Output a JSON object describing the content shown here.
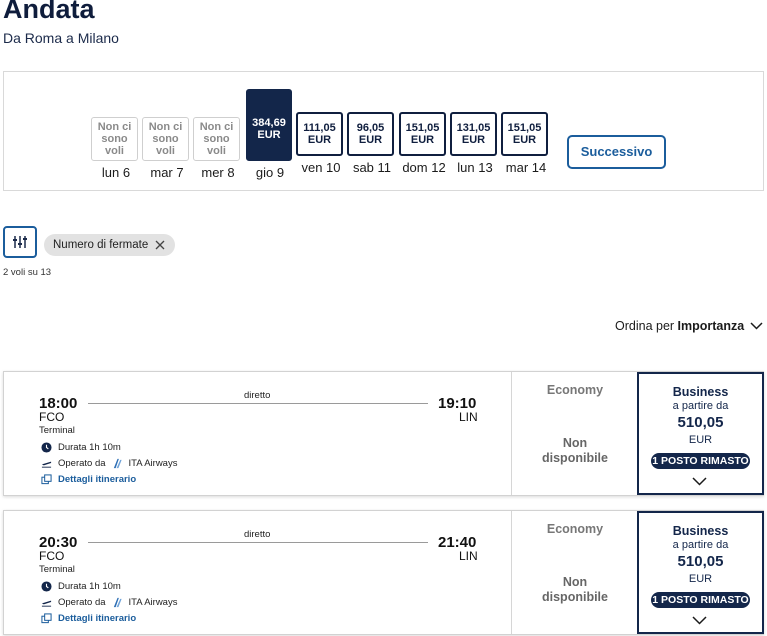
{
  "header": {
    "title": "Andata",
    "subtitle": "Da Roma a Milano"
  },
  "dates": [
    {
      "box_line1": "Non ci",
      "box_line2": "sono",
      "box_line3": "voli",
      "label": "lun 6",
      "state": "empty"
    },
    {
      "box_line1": "Non ci",
      "box_line2": "sono",
      "box_line3": "voli",
      "label": "mar 7",
      "state": "empty"
    },
    {
      "box_line1": "Non ci",
      "box_line2": "sono",
      "box_line3": "voli",
      "label": "mer 8",
      "state": "empty"
    },
    {
      "box_line1": "384,69",
      "box_line2": "EUR",
      "box_line3": "",
      "label": "gio 9",
      "state": "selected"
    },
    {
      "box_line1": "111,05",
      "box_line2": "EUR",
      "box_line3": "",
      "label": "ven 10",
      "state": "price"
    },
    {
      "box_line1": "96,05",
      "box_line2": "EUR",
      "box_line3": "",
      "label": "sab 11",
      "state": "price"
    },
    {
      "box_line1": "151,05",
      "box_line2": "EUR",
      "box_line3": "",
      "label": "dom 12",
      "state": "price"
    },
    {
      "box_line1": "131,05",
      "box_line2": "EUR",
      "box_line3": "",
      "label": "lun 13",
      "state": "price"
    },
    {
      "box_line1": "151,05",
      "box_line2": "EUR",
      "box_line3": "",
      "label": "mar 14",
      "state": "price"
    }
  ],
  "next_label": "Successivo",
  "filters": {
    "chip_label": "Numero di fermate",
    "count_text": "2 voli su 13"
  },
  "sort": {
    "prefix": "Ordina per",
    "value": "Importanza"
  },
  "flights": [
    {
      "dep_time": "18:00",
      "dep_airport": "FCO",
      "dep_terminal": "Terminal",
      "arr_time": "19:10",
      "arr_airport": "LIN",
      "stops": "diretto",
      "duration": "Durata 1h 10m",
      "operated_by": "Operato da",
      "airline": "ITA Airways",
      "details_link": "Dettagli itinerario",
      "economy_title": "Economy",
      "economy_na_1": "Non",
      "economy_na_2": "disponibile",
      "business_title": "Business",
      "business_from": "a partire da",
      "business_price": "510,05",
      "business_currency": "EUR",
      "seats_badge": "1 POSTO RIMASTO"
    },
    {
      "dep_time": "20:30",
      "dep_airport": "FCO",
      "dep_terminal": "Terminal",
      "arr_time": "21:40",
      "arr_airport": "LIN",
      "stops": "diretto",
      "duration": "Durata 1h 10m",
      "operated_by": "Operato da",
      "airline": "ITA Airways",
      "details_link": "Dettagli itinerario",
      "economy_title": "Economy",
      "economy_na_1": "Non",
      "economy_na_2": "disponibile",
      "business_title": "Business",
      "business_from": "a partire da",
      "business_price": "510,05",
      "business_currency": "EUR",
      "seats_badge": "1 POSTO RIMASTO"
    }
  ],
  "icons": {
    "filter": "sliders-icon",
    "chip_close": "close-icon",
    "sort": "chevron-down-icon",
    "duration": "clock-icon",
    "operated": "airplane-icon",
    "airline_logo": "ita-airways-logo",
    "details": "external-link-icon",
    "expand": "chevron-down-icon"
  },
  "colors": {
    "navy": "#13264a",
    "link_blue": "#1b5d9c"
  }
}
